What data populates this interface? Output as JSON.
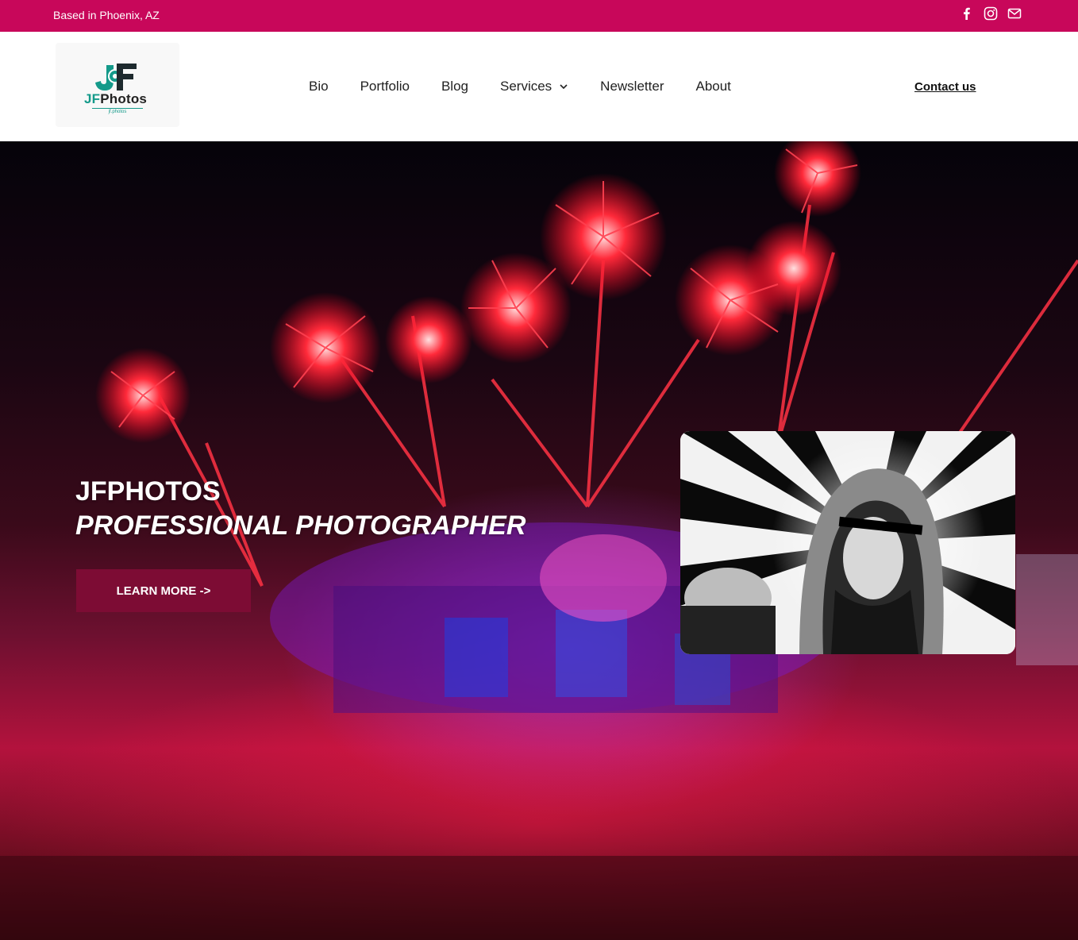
{
  "topbar": {
    "location": "Based in Phoenix, AZ",
    "social": [
      {
        "icon": "facebook-icon"
      },
      {
        "icon": "instagram-icon"
      },
      {
        "icon": "mail-icon"
      }
    ],
    "color": "#c8075a"
  },
  "header": {
    "logo": {
      "jf": "JF",
      "photos": "Photos",
      "tagline": "jf.photos"
    },
    "nav": [
      {
        "label": "Bio"
      },
      {
        "label": "Portfolio"
      },
      {
        "label": "Blog"
      },
      {
        "label": "Services",
        "has_dropdown": true
      },
      {
        "label": "Newsletter"
      },
      {
        "label": "About"
      }
    ],
    "contact_label": "Contact us"
  },
  "hero": {
    "title_line1": "JFPHOTOS",
    "title_line2": "PROFESSIONAL PHOTOGRAPHER",
    "cta_label": "LEARN MORE ->",
    "cta_color": "#7d0c34",
    "background": "festival stage with red fireworks"
  },
  "colors": {
    "accent": "#c8075a",
    "logo_teal": "#149a8a"
  }
}
